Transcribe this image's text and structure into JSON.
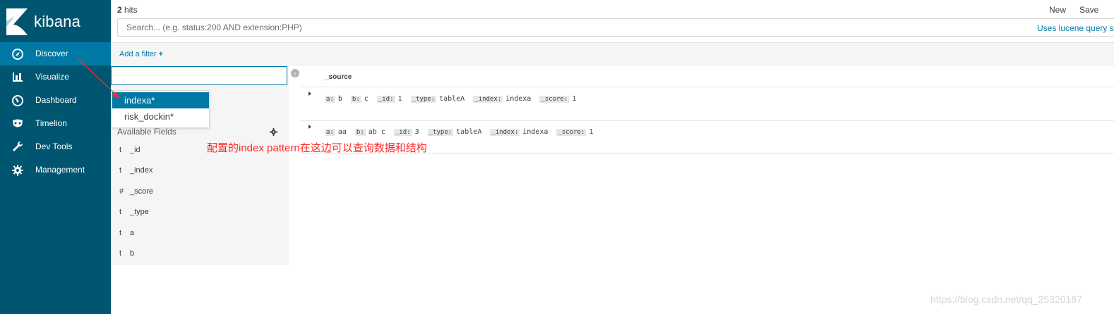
{
  "app": {
    "brand": "kibana"
  },
  "sidebar": {
    "items": [
      {
        "label": "Discover",
        "icon": "compass-icon",
        "active": true
      },
      {
        "label": "Visualize",
        "icon": "bar-chart-icon",
        "active": false
      },
      {
        "label": "Dashboard",
        "icon": "dashboard-gauge-icon",
        "active": false
      },
      {
        "label": "Timelion",
        "icon": "timelion-mask-icon",
        "active": false
      },
      {
        "label": "Dev Tools",
        "icon": "wrench-icon",
        "active": false
      },
      {
        "label": "Management",
        "icon": "gear-icon",
        "active": false
      }
    ]
  },
  "topbar": {
    "hits_count": "2",
    "hits_label": " hits",
    "new_label": "New",
    "save_label": "Save",
    "search_placeholder": "Search... (e.g. status:200 AND extension:PHP)",
    "lucene_link": "Uses lucene query syntax"
  },
  "filterbar": {
    "add_filter_label": "Add a filter",
    "plus": "+"
  },
  "index_dropdown": {
    "options": [
      "indexa*",
      "risk_dockin*"
    ],
    "selected": "indexa*"
  },
  "fields_panel": {
    "available_label": "Available Fields",
    "fields": [
      {
        "type": "t",
        "name": "_id"
      },
      {
        "type": "t",
        "name": "_index"
      },
      {
        "type": "#",
        "name": "_score"
      },
      {
        "type": "t",
        "name": "_type"
      },
      {
        "type": "t",
        "name": "a"
      },
      {
        "type": "t",
        "name": "b"
      }
    ]
  },
  "documents": {
    "column": "_source",
    "rows": [
      {
        "pairs": [
          [
            "a:",
            "b"
          ],
          [
            "b:",
            "c"
          ],
          [
            "_id:",
            "1"
          ],
          [
            "_type:",
            "tableA"
          ],
          [
            "_index:",
            "indexa"
          ],
          [
            "_score:",
            "1"
          ]
        ]
      },
      {
        "pairs": [
          [
            "a:",
            "aa"
          ],
          [
            "b:",
            "ab c"
          ],
          [
            "_id:",
            "3"
          ],
          [
            "_type:",
            "tableA"
          ],
          [
            "_index:",
            "indexa"
          ],
          [
            "_score:",
            "1"
          ]
        ]
      }
    ]
  },
  "annotation": {
    "text": "配置的index pattern在这边可以查询数据和结构",
    "color": "#ff2a2a"
  },
  "watermark": "https://blog.csdn.net/qq_25320187",
  "colors": {
    "sidebar": "#005571",
    "active": "#0079a5",
    "link": "#0079a5"
  }
}
